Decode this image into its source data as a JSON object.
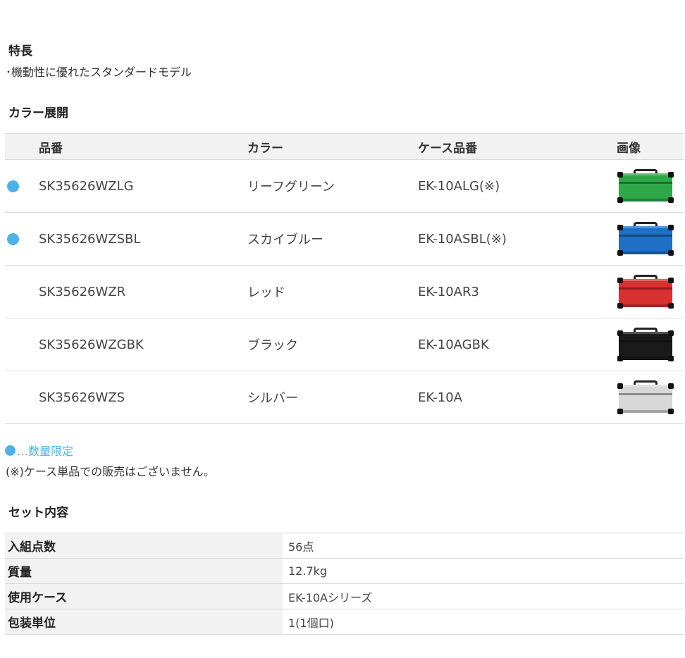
{
  "features": {
    "heading": "特長",
    "text": "･機動性に優れたスタンダードモデル"
  },
  "colors": {
    "heading": "カラー展開",
    "columns": [
      "品番",
      "カラー",
      "ケース品番",
      "画像"
    ],
    "rows": [
      {
        "part_no": "SK35626WZLG",
        "color": "リーフグリーン",
        "case_no": "EK-10ALG(※)",
        "limited": true,
        "swatch": "#2fa84a",
        "image": "green-tool-case"
      },
      {
        "part_no": "SK35626WZSBL",
        "color": "スカイブルー",
        "case_no": "EK-10ASBL(※)",
        "limited": true,
        "swatch": "#1f6fc4",
        "image": "blue-tool-case"
      },
      {
        "part_no": "SK35626WZR",
        "color": "レッド",
        "case_no": "EK-10AR3",
        "limited": false,
        "swatch": "#d93030",
        "image": "red-tool-case"
      },
      {
        "part_no": "SK35626WZGBK",
        "color": "ブラック",
        "case_no": "EK-10AGBK",
        "limited": false,
        "swatch": "#1a1a1a",
        "image": "black-tool-case"
      },
      {
        "part_no": "SK35626WZS",
        "color": "シルバー",
        "case_no": "EK-10A",
        "limited": false,
        "swatch": "#d8d8d8",
        "image": "silver-tool-case"
      }
    ],
    "dot_color": "#4bb3e8"
  },
  "notes": {
    "limited": "…数量限定",
    "case_note": "(※)ケース単品での販売はございません。"
  },
  "set_contents": {
    "heading": "セット内容",
    "rows": [
      {
        "label": "入組点数",
        "value": "56点"
      },
      {
        "label": "質量",
        "value": "12.7kg"
      },
      {
        "label": "使用ケース",
        "value": "EK-10Aシリーズ"
      },
      {
        "label": "包装単位",
        "value": "1(1個口)"
      }
    ]
  }
}
